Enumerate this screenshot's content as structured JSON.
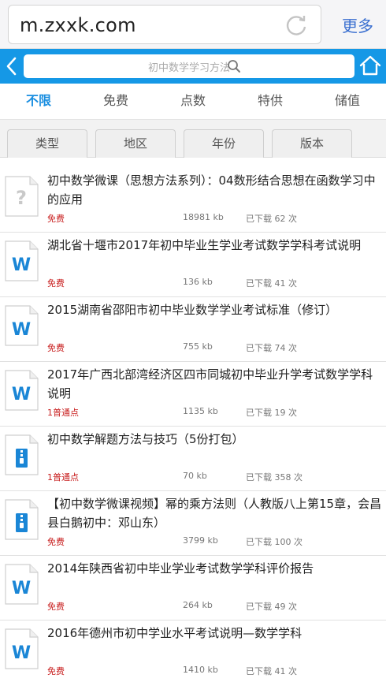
{
  "browser": {
    "url": "m.zxxk.com",
    "more_label": "更多"
  },
  "header": {
    "search_placeholder": "初中数学学习方法"
  },
  "price_tabs": [
    {
      "label": "不限",
      "active": true
    },
    {
      "label": "免费",
      "active": false
    },
    {
      "label": "点数",
      "active": false
    },
    {
      "label": "特供",
      "active": false
    },
    {
      "label": "储值",
      "active": false
    }
  ],
  "filters": [
    {
      "label": "类型"
    },
    {
      "label": "地区"
    },
    {
      "label": "年份"
    },
    {
      "label": "版本"
    }
  ],
  "colors": {
    "accent_blue": "#1598e6",
    "active_tab": "#1a8ee0",
    "price_red": "#c81f1f",
    "word_blue": "#1a86d6"
  },
  "documents": [
    {
      "icon": "unknown-file-icon",
      "title": "初中数学微课（思想方法系列）：04数形结合思想在函数学习中的应用",
      "price": "免费",
      "size": "18981 kb",
      "downloads": "已下载 62 次"
    },
    {
      "icon": "word-doc-icon",
      "title": "湖北省十堰市2017年初中毕业生学业考试数学学科考试说明",
      "price": "免费",
      "size": "136 kb",
      "downloads": "已下载 41 次"
    },
    {
      "icon": "word-doc-icon",
      "title": "2015湖南省邵阳市初中毕业数学学业考试标准（修订）",
      "price": "免费",
      "size": "755 kb",
      "downloads": "已下载 74 次"
    },
    {
      "icon": "word-doc-icon",
      "title": "2017年广西北部湾经济区四市同城初中毕业升学考试数学学科说明",
      "price": "1普通点",
      "size": "1135 kb",
      "downloads": "已下载 19 次"
    },
    {
      "icon": "zip-archive-icon",
      "title": "初中数学解题方法与技巧（5份打包）",
      "price": "1普通点",
      "size": "70 kb",
      "downloads": "已下载 358 次"
    },
    {
      "icon": "zip-archive-icon",
      "title": "【初中数学微课视频】幂的乘方法则（人教版八上第15章，会昌县白鹅初中：邓山东）",
      "price": "免费",
      "size": "3799 kb",
      "downloads": "已下载 100 次"
    },
    {
      "icon": "word-doc-icon",
      "title": "2014年陕西省初中毕业学业考试数学学科评价报告",
      "price": "免费",
      "size": "264 kb",
      "downloads": "已下载 49 次"
    },
    {
      "icon": "word-doc-icon",
      "title": "2016年德州市初中学业水平考试说明—数学学科",
      "price": "免费",
      "size": "1410 kb",
      "downloads": "已下载 41 次"
    }
  ]
}
